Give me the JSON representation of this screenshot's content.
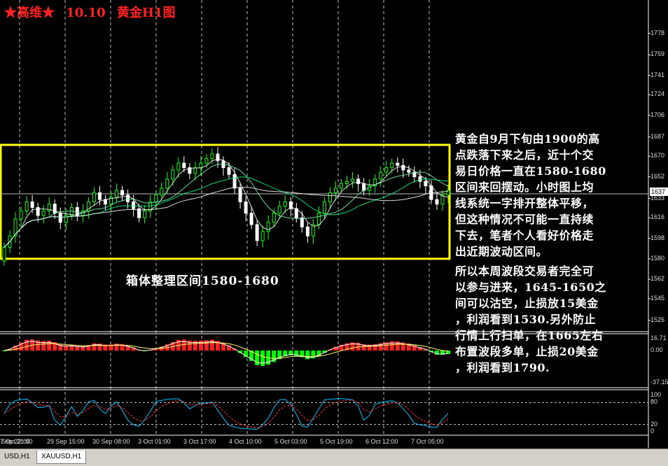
{
  "title": {
    "stars_name": "★高维★",
    "date": "10.10",
    "symbol_title": "黄金H1图"
  },
  "box_label": "箱体整理区间1580-1680",
  "note1": [
    "黄金自9月下旬由1900的高",
    "点跌落下来之后，近十个交",
    "易日价格一直在1580-1680",
    "区间来回摆动。小时图上均",
    "线系统一字排开整体平移，",
    "但这种情况不可能一直持续",
    "下去，笔者个人看好价格走",
    "出近期波动区间。"
  ],
  "note2": [
    "所以本周波段交易者完全可",
    "以参与进来，1645-1650之",
    "间可以沽空，止损放15美金",
    "，利润看到1530.另外防止",
    "行情上行扫单，在1665左右",
    "布置波段多单，止损20美金",
    "，利润看到1790."
  ],
  "tabs": [
    "USD,H1",
    "XAUUSD,H1"
  ],
  "chart_data": {
    "type": "line",
    "price_axis_labels": [
      "1778",
      "1759",
      "1741",
      "1724",
      "1706",
      "1687",
      "1670",
      "1652",
      "1633",
      "1616",
      "1598",
      "1580",
      "1562",
      "1545",
      "1526"
    ],
    "current_price": "1637",
    "macd_axis_labels": [
      "16.71",
      "0.00",
      "-37.15"
    ],
    "stoch_axis_labels": [
      "100",
      "80",
      "20",
      "0"
    ],
    "time_labels": [
      "Sep 22:00",
      "29 Sep 15:00",
      "30 Sep 08:00",
      "3 Oct 01:00",
      "3 Oct 17:00",
      "4 Oct 10:00",
      "5 Oct 03:00",
      "5 Oct 19:00",
      "6 Oct 12:00",
      "7 Oct 05:00",
      "7 Oct 21:00"
    ],
    "range_box": [
      1580,
      1680
    ],
    "price_ylim": [
      1516,
      1790
    ],
    "price_close": [
      1590,
      1600,
      1615,
      1622,
      1630,
      1625,
      1618,
      1622,
      1628,
      1620,
      1612,
      1618,
      1625,
      1618,
      1622,
      1630,
      1638,
      1632,
      1628,
      1634,
      1640,
      1636,
      1630,
      1624,
      1616,
      1622,
      1630,
      1636,
      1642,
      1650,
      1658,
      1664,
      1660,
      1655,
      1660,
      1664,
      1668,
      1672,
      1666,
      1660,
      1654,
      1642,
      1630,
      1620,
      1610,
      1596,
      1604,
      1612,
      1620,
      1626,
      1630,
      1624,
      1616,
      1608,
      1600,
      1610,
      1620,
      1630,
      1638,
      1642,
      1646,
      1648,
      1650,
      1646,
      1640,
      1644,
      1650,
      1656,
      1660,
      1664,
      1662,
      1658,
      1656,
      1652,
      1648,
      1644,
      1632,
      1628,
      1636,
      1640
    ],
    "colors": {
      "box": "#ffff00",
      "bull": "#00ff00",
      "bear": "#ffffff",
      "grid": "#ffffff",
      "macd_pos": "#ff2020",
      "macd_neg": "#00ff00",
      "stoch_main": "#00bfff",
      "stoch_signal": "#ff3030"
    }
  }
}
